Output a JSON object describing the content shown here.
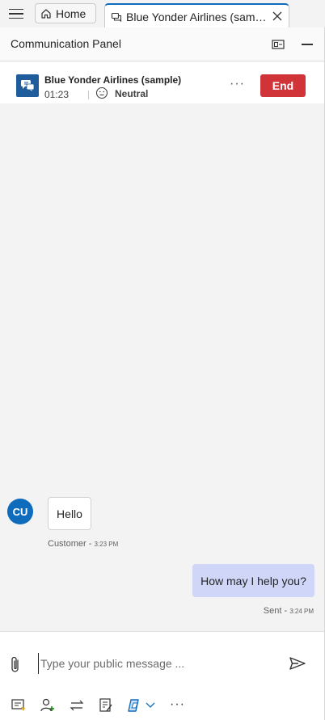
{
  "tabs": {
    "home_label": "Home",
    "session_label": "Blue Yonder Airlines (sample)"
  },
  "panel": {
    "title": "Communication Panel"
  },
  "session": {
    "customer_name": "Blue Yonder Airlines (sample)",
    "timer": "01:23",
    "sentiment": "Neutral",
    "end_label": "End",
    "more_label": "···"
  },
  "conversation": {
    "customer_avatar": "CU",
    "messages": [
      {
        "text": "Hello",
        "author": "Customer",
        "separator": " - ",
        "time": "3:23 PM",
        "direction": "in"
      },
      {
        "text": "How may I help you?",
        "author": "Sent",
        "separator": " - ",
        "time": "3:24 PM",
        "direction": "out"
      }
    ]
  },
  "compose": {
    "placeholder": "Type your public message ...",
    "value": "",
    "more_label": "···"
  },
  "colors": {
    "accent": "#0f6cbd",
    "end_button": "#d13438",
    "outgoing_bubble": "#cfd6f8",
    "session_icon": "#1f5c9b"
  },
  "icons": {
    "menu": "hamburger-icon",
    "home": "home-icon",
    "session_tab": "chat-icon",
    "close": "close-icon",
    "popout": "popout-icon",
    "minimize": "minimize-icon",
    "sentiment": "neutral-face-icon",
    "attach": "paperclip-icon",
    "send": "send-icon",
    "toolbar": [
      "quick-replies-icon",
      "consult-icon",
      "transfer-icon",
      "notes-icon",
      "copilot-icon",
      "chevron-down-icon",
      "more-icon"
    ]
  }
}
